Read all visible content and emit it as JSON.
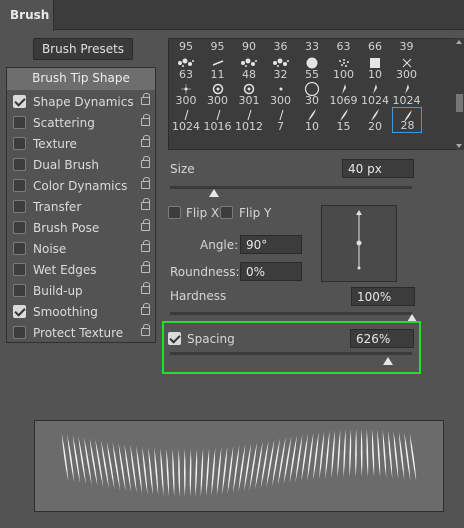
{
  "panel": {
    "tab": "Brush",
    "presets_button": "Brush Presets"
  },
  "left": {
    "tip_shape": "Brush Tip Shape",
    "options": [
      {
        "label": "Shape Dynamics",
        "checked": true
      },
      {
        "label": "Scattering",
        "checked": false
      },
      {
        "label": "Texture",
        "checked": false
      },
      {
        "label": "Dual Brush",
        "checked": false
      },
      {
        "label": "Color Dynamics",
        "checked": false
      },
      {
        "label": "Transfer",
        "checked": false
      },
      {
        "label": "Brush Pose",
        "checked": false
      },
      {
        "label": "Noise",
        "checked": false
      },
      {
        "label": "Wet Edges",
        "checked": false
      },
      {
        "label": "Build-up",
        "checked": false
      },
      {
        "label": "Smoothing",
        "checked": true
      },
      {
        "label": "Protect Texture",
        "checked": false
      }
    ]
  },
  "brush_grid": {
    "top_row": [
      "95",
      "95",
      "90",
      "36",
      "33",
      "63",
      "66",
      "39"
    ],
    "rows": [
      [
        {
          "n": "63",
          "icon": "splatter"
        },
        {
          "n": "11",
          "icon": "dash"
        },
        {
          "n": "48",
          "icon": "splatter"
        },
        {
          "n": "32",
          "icon": "splatter"
        },
        {
          "n": "55",
          "icon": "circle"
        },
        {
          "n": "100",
          "icon": "dots"
        },
        {
          "n": "10",
          "icon": "square"
        },
        {
          "n": "300",
          "icon": "cross"
        }
      ],
      [
        {
          "n": "300",
          "icon": "star"
        },
        {
          "n": "300",
          "icon": "ring"
        },
        {
          "n": "301",
          "icon": "ring"
        },
        {
          "n": "300",
          "icon": "small-dot"
        },
        {
          "n": "30",
          "icon": "big-circle"
        },
        {
          "n": "1069",
          "icon": "stroke"
        },
        {
          "n": "1024",
          "icon": "stroke"
        },
        {
          "n": "1024",
          "icon": "stroke"
        }
      ],
      [
        {
          "n": "1024",
          "icon": "tick"
        },
        {
          "n": "1016",
          "icon": "tick"
        },
        {
          "n": "1012",
          "icon": "tick"
        },
        {
          "n": "7",
          "icon": "tick"
        },
        {
          "n": "10",
          "icon": "blade"
        },
        {
          "n": "15",
          "icon": "blade"
        },
        {
          "n": "20",
          "icon": "blade"
        },
        {
          "n": "28",
          "icon": "blade",
          "selected": true
        }
      ]
    ]
  },
  "size": {
    "label": "Size",
    "value": "40 px",
    "level": 0.18
  },
  "flip_x": {
    "label": "Flip X",
    "checked": false
  },
  "flip_y": {
    "label": "Flip Y",
    "checked": false
  },
  "angle": {
    "label": "Angle:",
    "value": "90°"
  },
  "roundness": {
    "label": "Roundness:",
    "value": "0%"
  },
  "hardness": {
    "label": "Hardness",
    "value": "100%",
    "level": 1.0
  },
  "spacing": {
    "label": "Spacing",
    "value": "626%",
    "checked": true,
    "level": 0.9
  },
  "colors": {
    "panel": "#535353",
    "highlight": "#21e02a",
    "selection": "#3e9cd8"
  }
}
